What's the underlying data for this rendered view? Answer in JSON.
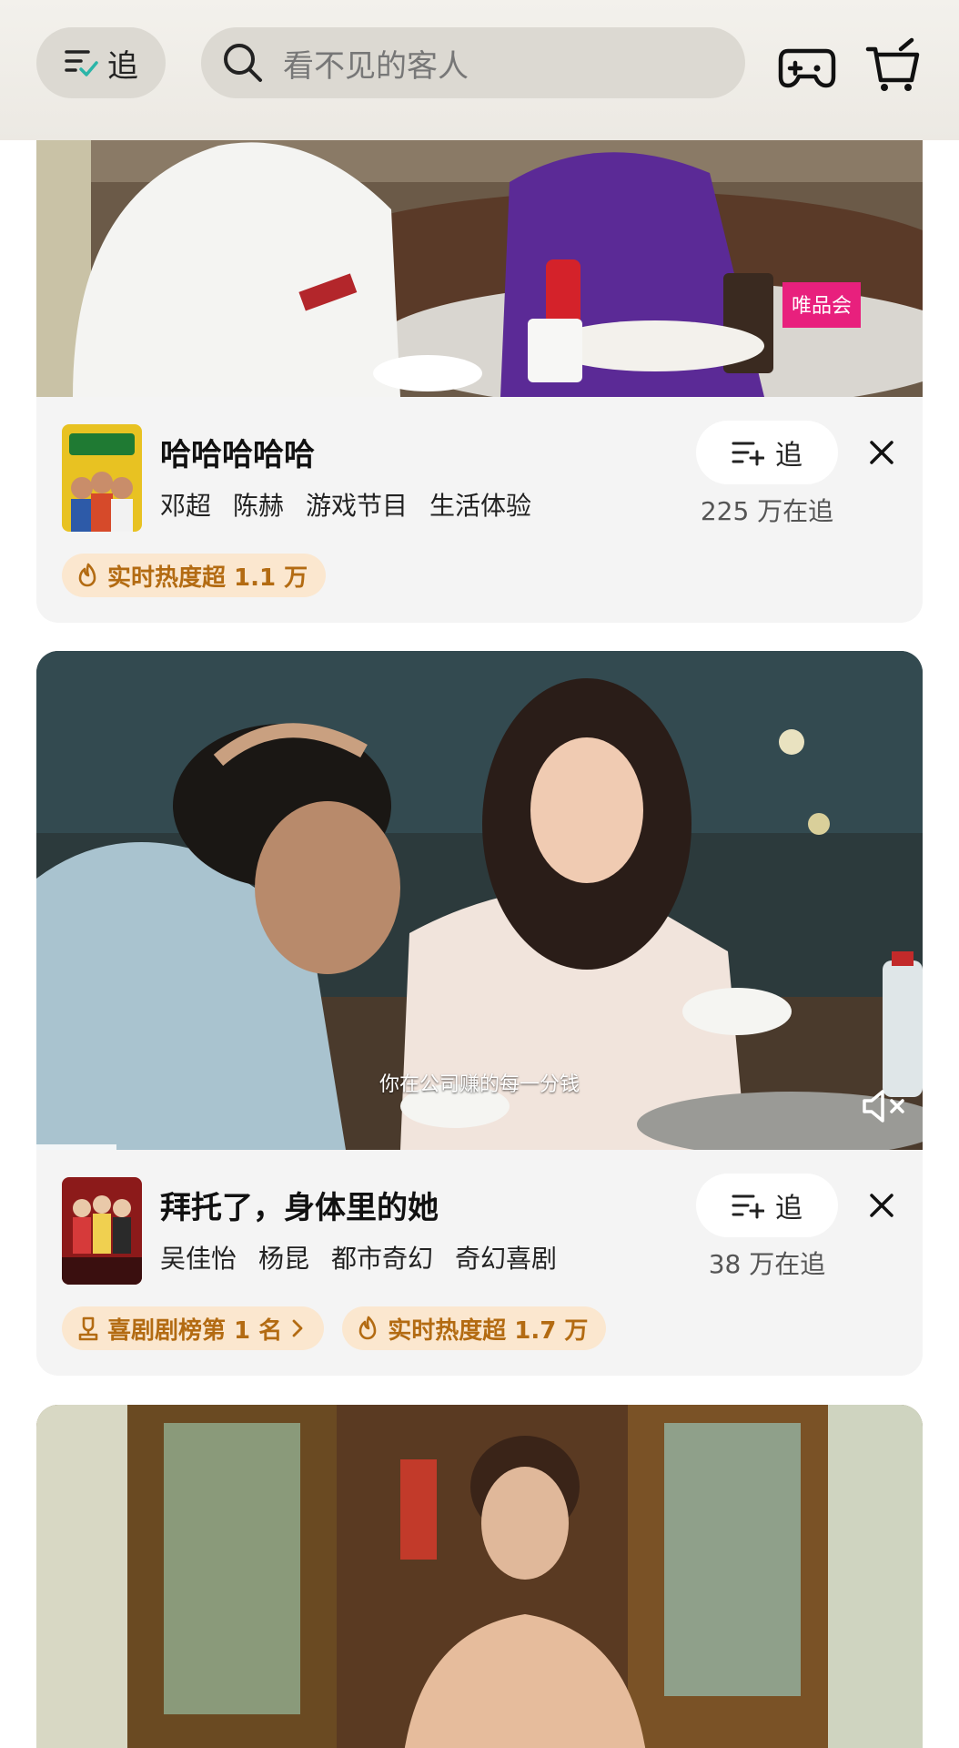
{
  "header": {
    "follow_label": "追",
    "search_placeholder": "看不见的客人"
  },
  "cards": [
    {
      "title": "哈哈哈哈哈",
      "tags": [
        "邓超",
        "陈赫",
        "游戏节目",
        "生活体验"
      ],
      "follow_label": "追",
      "follow_count": "225 万在追",
      "badges": [
        {
          "icon": "flame-icon",
          "text": "实时热度超 1.1 万"
        }
      ],
      "thumbnail_watermark": "唯品会"
    },
    {
      "title": "拜托了，身体里的她",
      "tags": [
        "吴佳怡",
        "杨昆",
        "都市奇幻",
        "奇幻喜剧"
      ],
      "follow_label": "追",
      "follow_count": "38 万在追",
      "subtitle": "你在公司赚的每一分钱",
      "badges": [
        {
          "icon": "trophy-icon",
          "text": "喜剧剧榜第 1 名"
        },
        {
          "icon": "flame-icon",
          "text": "实时热度超 1.7 万"
        }
      ],
      "playback_progress_fraction": 0.09
    }
  ],
  "colors": {
    "header_bg": "#eeebe5",
    "card_bg": "#f4f4f4",
    "badge_bg": "#fbe7cf",
    "badge_text": "#b36b12",
    "check_accent": "#2bb5a8"
  }
}
